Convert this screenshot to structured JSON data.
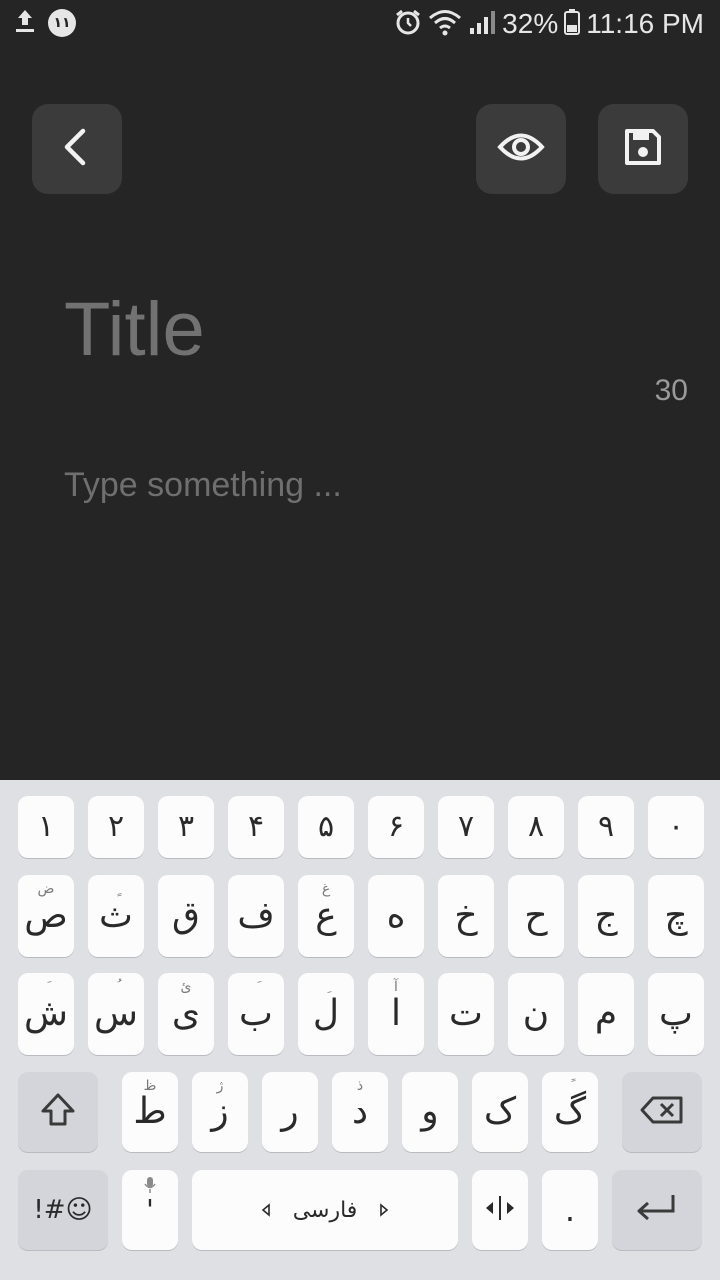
{
  "status_bar": {
    "badge": "۱۱",
    "battery": "32%",
    "time": "11:16 PM",
    "icons": [
      "upload-icon",
      "notification-badge",
      "alarm-icon",
      "wifi-icon",
      "signal-icon",
      "battery-icon"
    ]
  },
  "editor": {
    "title_placeholder": "Title",
    "char_counter": "30",
    "body_placeholder": "Type something ..."
  },
  "toolbar": {
    "back_icon": "chevron-left-icon",
    "preview_icon": "eye-icon",
    "save_icon": "floppy-disk-icon"
  },
  "keyboard": {
    "number_row": [
      "۱",
      "۲",
      "۳",
      "۴",
      "۵",
      "۶",
      "۷",
      "۸",
      "۹",
      "۰"
    ],
    "row1": [
      {
        "main": "ص",
        "hint": "ض"
      },
      {
        "main": "ث",
        "hint": "ٍ"
      },
      {
        "main": "ق",
        "hint": ""
      },
      {
        "main": "ف",
        "hint": ""
      },
      {
        "main": "ع",
        "hint": "غ"
      },
      {
        "main": "ه",
        "hint": ""
      },
      {
        "main": "خ",
        "hint": ""
      },
      {
        "main": "ح",
        "hint": ""
      },
      {
        "main": "ج",
        "hint": ""
      },
      {
        "main": "چ",
        "hint": ""
      }
    ],
    "row2": [
      {
        "main": "ش",
        "hint": "َ"
      },
      {
        "main": "س",
        "hint": "ُ"
      },
      {
        "main": "ی",
        "hint": "ئ"
      },
      {
        "main": "ب",
        "hint": "َ"
      },
      {
        "main": "ل",
        "hint": "ِ"
      },
      {
        "main": "ا",
        "hint": "آ"
      },
      {
        "main": "ت",
        "hint": ""
      },
      {
        "main": "ن",
        "hint": ""
      },
      {
        "main": "م",
        "hint": ""
      },
      {
        "main": "پ",
        "hint": ""
      }
    ],
    "row3": [
      {
        "main": "ط",
        "hint": "ظ"
      },
      {
        "main": "ز",
        "hint": "ژ"
      },
      {
        "main": "ر",
        "hint": ""
      },
      {
        "main": "د",
        "hint": "ذ"
      },
      {
        "main": "و",
        "hint": ""
      },
      {
        "main": "ک",
        "hint": ""
      },
      {
        "main": "گ",
        "hint": "ً"
      }
    ],
    "symbols_label": "!#☺",
    "comma_label": "'",
    "space_label": "فارسی",
    "period_label": ".",
    "shift_icon": "shift-icon",
    "backspace_icon": "backspace-icon",
    "enter_icon": "enter-icon",
    "cursor_icon": "cursor-move-icon",
    "mic_icon": "mic-icon"
  }
}
